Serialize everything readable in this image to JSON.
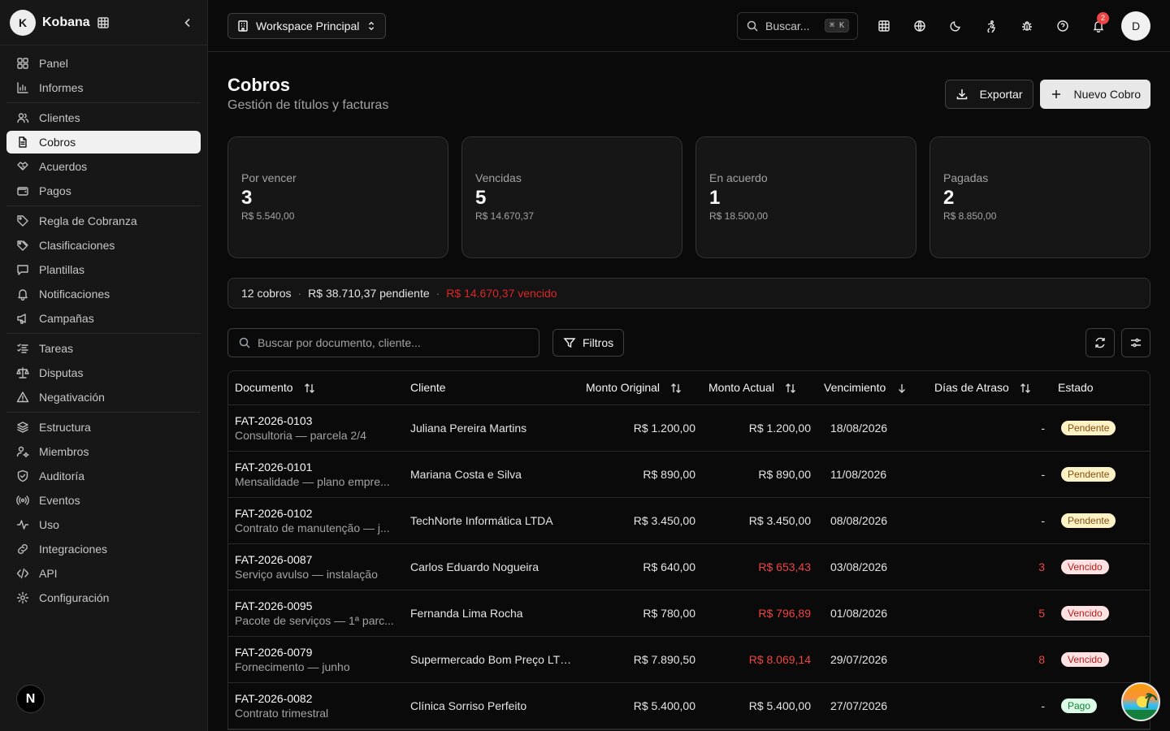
{
  "brand": {
    "initial": "K",
    "name": "Kobana"
  },
  "sidebar": {
    "groups": [
      [
        {
          "label": "Panel",
          "icon": "dashboard-icon"
        },
        {
          "label": "Informes",
          "icon": "bar-chart-icon"
        }
      ],
      [
        {
          "label": "Clientes",
          "icon": "users-icon"
        },
        {
          "label": "Cobros",
          "icon": "file-text-icon",
          "active": true
        },
        {
          "label": "Acuerdos",
          "icon": "handshake-icon"
        },
        {
          "label": "Pagos",
          "icon": "wallet-icon"
        }
      ],
      [
        {
          "label": "Regla de Cobranza",
          "icon": "tag-icon"
        },
        {
          "label": "Clasificaciones",
          "icon": "tags-icon"
        },
        {
          "label": "Plantillas",
          "icon": "message-square-icon"
        },
        {
          "label": "Notificaciones",
          "icon": "bell-icon"
        },
        {
          "label": "Campañas",
          "icon": "megaphone-icon"
        }
      ],
      [
        {
          "label": "Tareas",
          "icon": "list-checks-icon"
        },
        {
          "label": "Disputas",
          "icon": "scale-icon"
        },
        {
          "label": "Negativación",
          "icon": "alert-triangle-icon"
        }
      ],
      [
        {
          "label": "Estructura",
          "icon": "layers-icon"
        },
        {
          "label": "Miembros",
          "icon": "user-cog-icon"
        },
        {
          "label": "Auditoría",
          "icon": "shield-check-icon"
        },
        {
          "label": "Eventos",
          "icon": "radio-icon"
        },
        {
          "label": "Uso",
          "icon": "activity-icon"
        },
        {
          "label": "Integraciones",
          "icon": "link-icon"
        },
        {
          "label": "API",
          "icon": "code-icon"
        },
        {
          "label": "Configuración",
          "icon": "settings-icon"
        }
      ]
    ],
    "footer_badge": "N"
  },
  "topbar": {
    "workspace": "Workspace Principal",
    "search_placeholder": "Buscar...",
    "search_shortcut": "⌘ K",
    "notification_count": "2",
    "user_initial": "D"
  },
  "page": {
    "title": "Cobros",
    "subtitle": "Gestión de títulos y facturas",
    "export_label": "Exportar",
    "new_label": "Nuevo Cobro"
  },
  "stats": [
    {
      "label": "Por vencer",
      "count": "3",
      "amount": "R$ 5.540,00"
    },
    {
      "label": "Vencidas",
      "count": "5",
      "amount": "R$ 14.670,37"
    },
    {
      "label": "En acuerdo",
      "count": "1",
      "amount": "R$ 18.500,00"
    },
    {
      "label": "Pagadas",
      "count": "2",
      "amount": "R$ 8.850,00"
    }
  ],
  "summary": {
    "count": "12 cobros",
    "pending": "R$ 38.710,37 pendiente",
    "overdue": "R$ 14.670,37 vencido",
    "separator": "·"
  },
  "toolbar": {
    "search_placeholder": "Buscar por documento, cliente...",
    "filter_label": "Filtros"
  },
  "table": {
    "columns": [
      "Documento",
      "Cliente",
      "Monto Original",
      "Monto Actual",
      "Vencimiento",
      "Días de Atraso",
      "Estado"
    ],
    "rows": [
      {
        "doc": "FAT-2026-0103",
        "desc": "Consultoria — parcela 2/4",
        "client": "Juliana Pereira Martins",
        "original": "R$ 1.200,00",
        "current": "R$ 1.200,00",
        "current_red": false,
        "due": "18/08/2026",
        "delay": "-",
        "delay_red": false,
        "status": "Pendente",
        "status_type": "pendente"
      },
      {
        "doc": "FAT-2026-0101",
        "desc": "Mensalidade — plano empre...",
        "client": "Mariana Costa e Silva",
        "original": "R$ 890,00",
        "current": "R$ 890,00",
        "current_red": false,
        "due": "11/08/2026",
        "delay": "-",
        "delay_red": false,
        "status": "Pendente",
        "status_type": "pendente"
      },
      {
        "doc": "FAT-2026-0102",
        "desc": "Contrato de manutenção — j...",
        "client": "TechNorte Informática LTDA",
        "original": "R$ 3.450,00",
        "current": "R$ 3.450,00",
        "current_red": false,
        "due": "08/08/2026",
        "delay": "-",
        "delay_red": false,
        "status": "Pendente",
        "status_type": "pendente"
      },
      {
        "doc": "FAT-2026-0087",
        "desc": "Serviço avulso — instalação",
        "client": "Carlos Eduardo Nogueira",
        "original": "R$ 640,00",
        "current": "R$ 653,43",
        "current_red": true,
        "due": "03/08/2026",
        "delay": "3",
        "delay_red": true,
        "status": "Vencido",
        "status_type": "vencido"
      },
      {
        "doc": "FAT-2026-0095",
        "desc": "Pacote de serviços — 1ª parc...",
        "client": "Fernanda Lima Rocha",
        "original": "R$ 780,00",
        "current": "R$ 796,89",
        "current_red": true,
        "due": "01/08/2026",
        "delay": "5",
        "delay_red": true,
        "status": "Vencido",
        "status_type": "vencido"
      },
      {
        "doc": "FAT-2026-0079",
        "desc": "Fornecimento — junho",
        "client": "Supermercado Bom Preço LTDA",
        "original": "R$ 7.890,50",
        "current": "R$ 8.069,14",
        "current_red": true,
        "due": "29/07/2026",
        "delay": "8",
        "delay_red": true,
        "status": "Vencido",
        "status_type": "vencido"
      },
      {
        "doc": "FAT-2026-0082",
        "desc": "Contrato trimestral",
        "client": "Clínica Sorriso Perfeito",
        "original": "R$ 5.400,00",
        "current": "R$ 5.400,00",
        "current_red": false,
        "due": "27/07/2026",
        "delay": "-",
        "delay_red": false,
        "status": "Pago",
        "status_type": "pago"
      }
    ]
  }
}
